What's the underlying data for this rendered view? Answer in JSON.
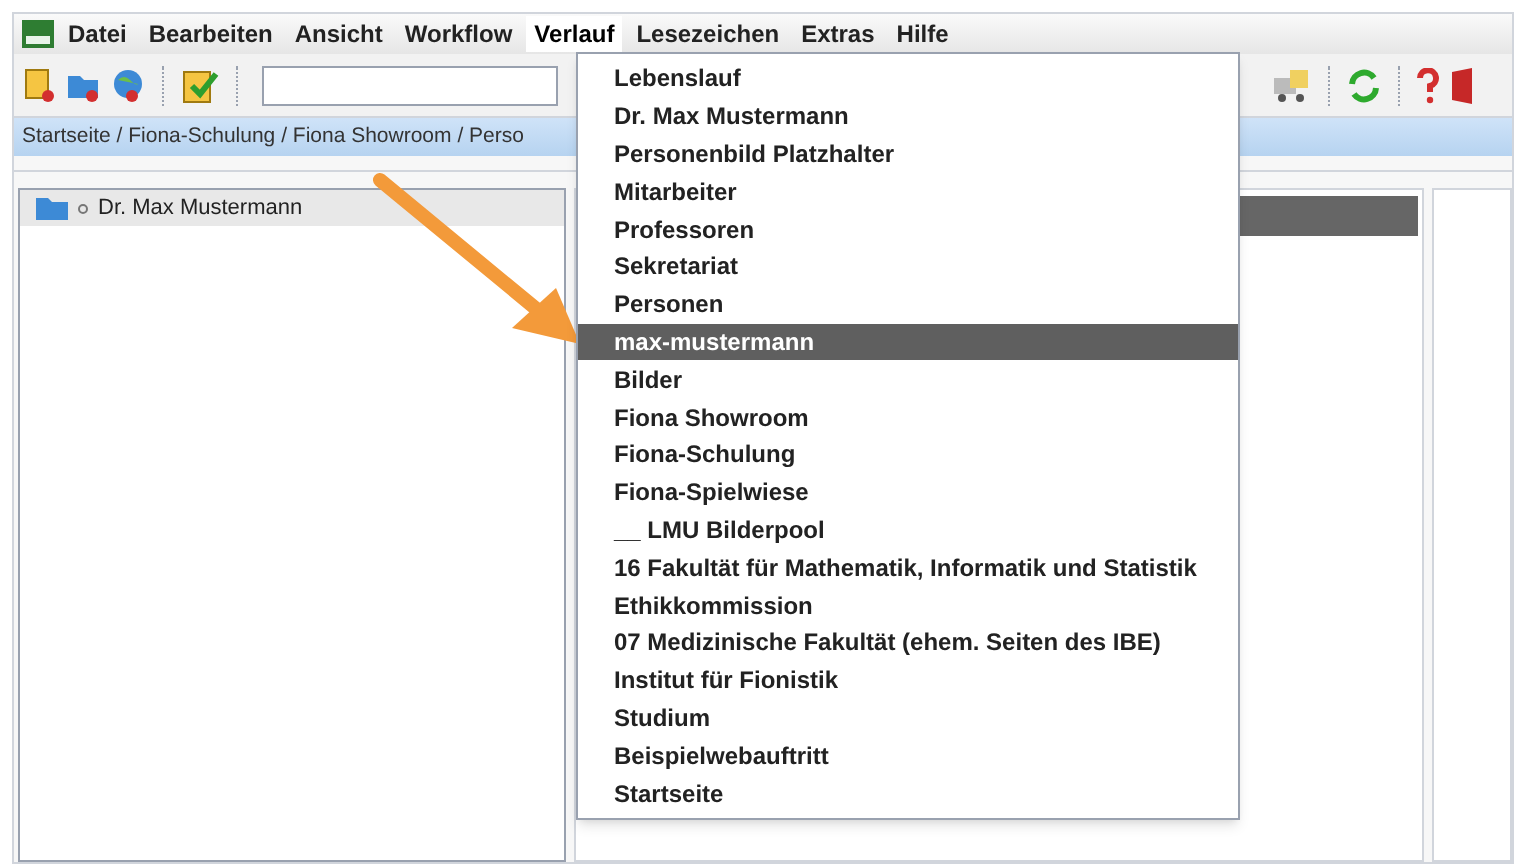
{
  "menu_bar": [
    {
      "label": "Datei",
      "open": false
    },
    {
      "label": "Bearbeiten",
      "open": false
    },
    {
      "label": "Ansicht",
      "open": false
    },
    {
      "label": "Workflow",
      "open": false
    },
    {
      "label": "Verlauf",
      "open": true
    },
    {
      "label": "Lesezeichen",
      "open": false
    },
    {
      "label": "Extras",
      "open": false
    },
    {
      "label": "Hilfe",
      "open": false
    }
  ],
  "breadcrumb": "Startseite / Fiona-Schulung / Fiona Showroom / Perso",
  "tree": {
    "items": [
      {
        "label": "Dr. Max Mustermann"
      }
    ]
  },
  "history_menu": [
    {
      "label": "Lebenslauf",
      "selected": false
    },
    {
      "label": "Dr. Max Mustermann",
      "selected": false
    },
    {
      "label": "Personenbild Platzhalter",
      "selected": false
    },
    {
      "label": "Mitarbeiter",
      "selected": false
    },
    {
      "label": "Professoren",
      "selected": false
    },
    {
      "label": "Sekretariat",
      "selected": false
    },
    {
      "label": "Personen",
      "selected": false
    },
    {
      "label": "max-mustermann",
      "selected": true
    },
    {
      "label": "Bilder",
      "selected": false
    },
    {
      "label": "Fiona Showroom",
      "selected": false
    },
    {
      "label": "Fiona-Schulung",
      "selected": false
    },
    {
      "label": "Fiona-Spielwiese",
      "selected": false
    },
    {
      "label": "__ LMU Bilderpool",
      "selected": false
    },
    {
      "label": "16 Fakultät für Mathematik, Informatik und Statistik",
      "selected": false
    },
    {
      "label": "Ethikkommission",
      "selected": false
    },
    {
      "label": "07 Medizinische Fakultät (ehem. Seiten des IBE)",
      "selected": false
    },
    {
      "label": "Institut für Fionistik",
      "selected": false
    },
    {
      "label": "Studium",
      "selected": false
    },
    {
      "label": "Beispielwebauftritt",
      "selected": false
    },
    {
      "label": "Startseite",
      "selected": false
    }
  ]
}
